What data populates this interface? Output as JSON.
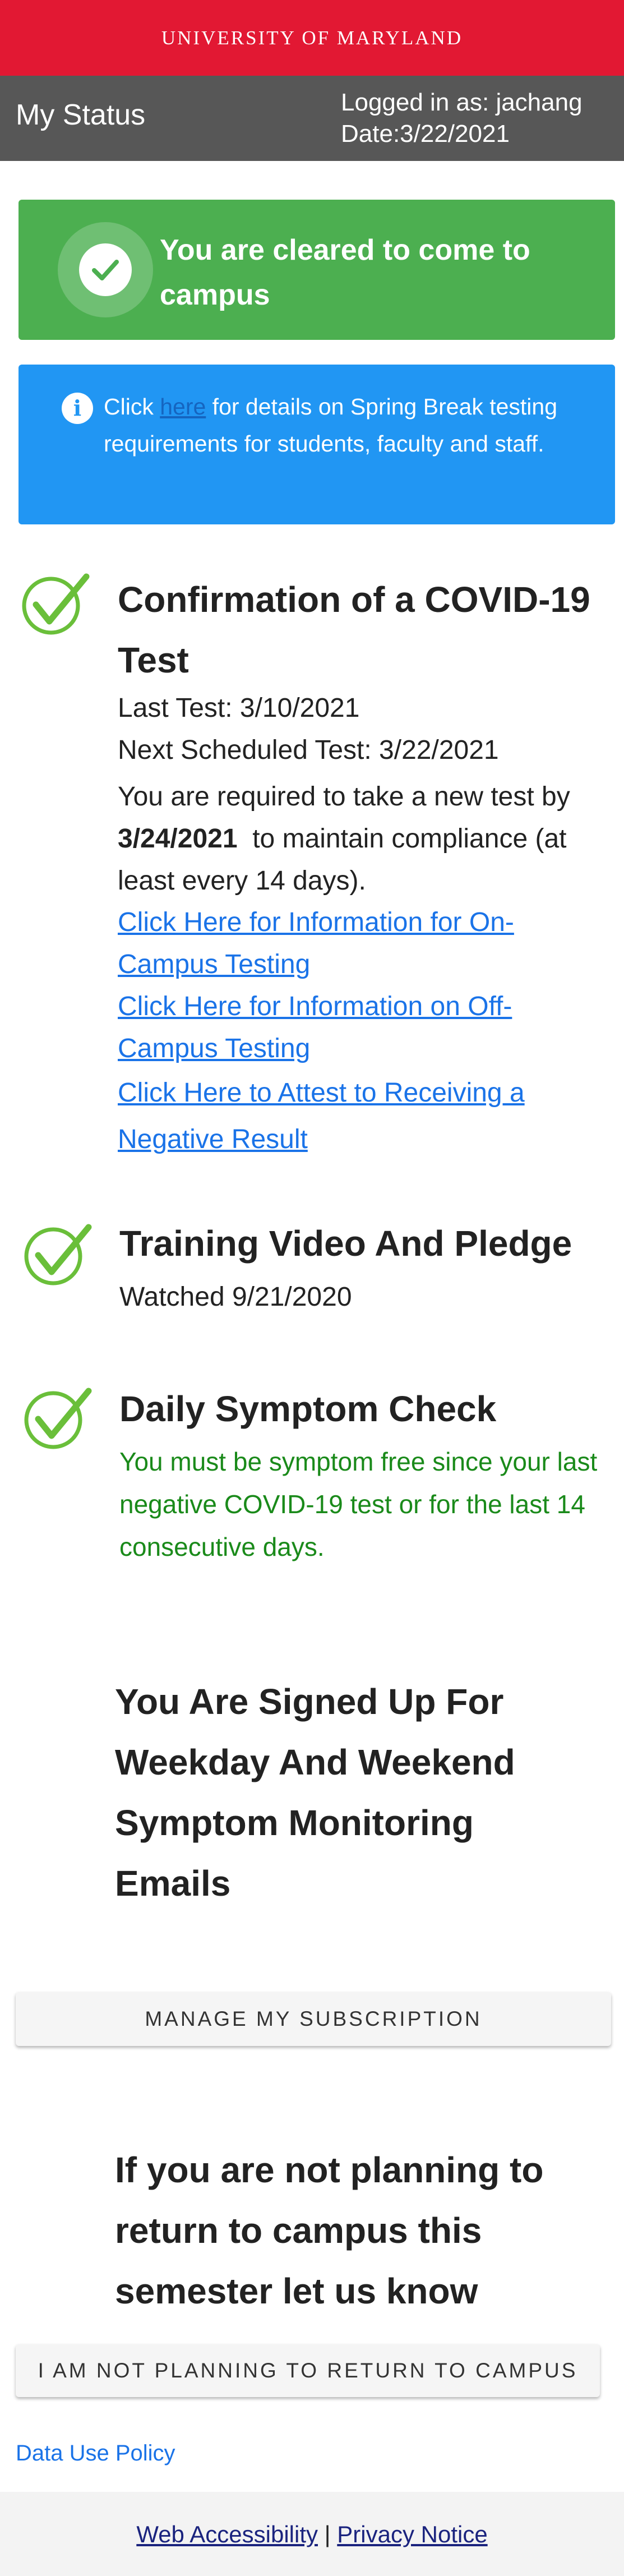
{
  "header": {
    "university": "UNIVERSITY OF MARYLAND"
  },
  "status_bar": {
    "title": "My Status",
    "logged_in": "Logged in as: jachang",
    "date": "Date:3/22/2021"
  },
  "cleared_card": {
    "message": "You are cleared to come to campus",
    "icon": "check-icon",
    "color": "#4caf50"
  },
  "info_card": {
    "prefix": "Click ",
    "link": "here",
    "suffix": " for details on Spring Break testing requirements for students, faculty and staff.",
    "icon": "info-icon",
    "color": "#2196f3"
  },
  "covid_test": {
    "title": "Confirmation of a COVID-19 Test",
    "last_test": "Last Test: 3/10/2021",
    "next_test": "Next Scheduled Test: 3/22/2021",
    "requirement_prefix": "You are required to take a new test by",
    "requirement_date": "3/24/2021",
    "requirement_suffix": "to maintain compliance (at least every 14 days).",
    "links": [
      "Click Here for Information for On-Campus Testing",
      "Click Here for Information on Off-Campus Testing",
      "Click Here to Attest to Receiving a Negative Result"
    ]
  },
  "training": {
    "title": "Training Video And Pledge",
    "watched": "Watched 9/21/2020"
  },
  "symptom_check": {
    "title": "Daily Symptom Check",
    "note": "You must be symptom free since your last negative COVID-19 test or for the last 14 consecutive days."
  },
  "subscription": {
    "heading": "You Are Signed Up For Weekday And Weekend Symptom Monitoring Emails",
    "button": "Manage My Subscription"
  },
  "not_returning": {
    "heading": "If you are not planning to return to campus this semester let us know",
    "button": "I am not planning to return to campus"
  },
  "data_use": "Data Use Policy",
  "footer": {
    "accessibility": "Web Accessibility",
    "separator": "|",
    "privacy": "Privacy Notice"
  }
}
